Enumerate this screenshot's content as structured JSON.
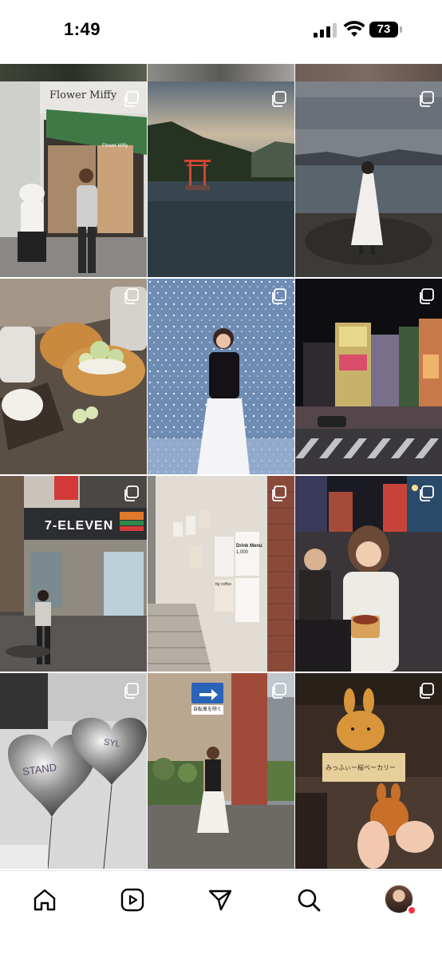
{
  "status_bar": {
    "time": "1:49",
    "battery": "73"
  },
  "grid": {
    "tiles": [
      {
        "label": "Flower Miffy storefront with Miffy statue",
        "kind": "carousel"
      },
      {
        "label": "Red torii gate on lake",
        "kind": "carousel"
      },
      {
        "label": "Woman in white dress by lake",
        "kind": "carousel"
      },
      {
        "label": "Pastries and coffee on tray",
        "kind": "carousel"
      },
      {
        "label": "Woman in light installation",
        "kind": "carousel"
      },
      {
        "label": "Akihabara street at night",
        "kind": "carousel"
      },
      {
        "label": "Woman outside 7-Eleven",
        "kind": "carousel"
      },
      {
        "label": "Cafe menu posters on wall",
        "kind": "carousel"
      },
      {
        "label": "Woman eating at night street",
        "kind": "carousel"
      },
      {
        "label": "Chrome heart balloons",
        "kind": "carousel"
      },
      {
        "label": "Woman on small street with sign",
        "kind": "carousel"
      },
      {
        "label": "Miffy shaped bread in hand",
        "kind": "carousel"
      }
    ],
    "text": {
      "store_sign": "Flower Miffy",
      "store_sign_small": "Flower Miffy",
      "seven_eleven": "7-ELEVEN",
      "balloon_1": "STAND",
      "balloon_2": "SYL",
      "menu_title": "Drink Menu",
      "menu_price": "1,000",
      "menu_cafe": "fig coffee",
      "bakery_sign": "みっふぃー桜ベーカリー",
      "road_sign": "自転車を除く"
    }
  },
  "tab_bar": {
    "items": [
      "home-icon",
      "reels-icon",
      "direct-icon",
      "search-icon",
      "profile-avatar"
    ]
  }
}
